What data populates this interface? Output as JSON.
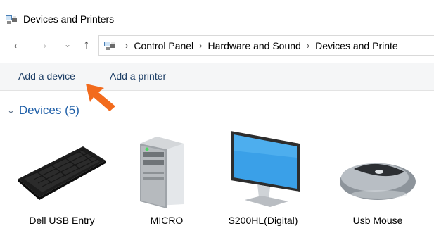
{
  "window": {
    "title": "Devices and Printers"
  },
  "navigation": {
    "back_icon": "back-arrow-icon",
    "forward_icon": "forward-arrow-icon",
    "recent_icon": "chevron-down-icon",
    "up_icon": "up-arrow-icon",
    "breadcrumbs": [
      "Control Panel",
      "Hardware and Sound",
      "Devices and Printe"
    ]
  },
  "toolbar": {
    "add_device_label": "Add a device",
    "add_printer_label": "Add a printer"
  },
  "devices_group": {
    "title": "Devices (5)",
    "items": [
      {
        "label": "Dell USB Entry",
        "icon": "keyboard-icon"
      },
      {
        "label": "MICRO",
        "icon": "computer-tower-icon"
      },
      {
        "label": "S200HL(Digital)",
        "icon": "monitor-icon"
      },
      {
        "label": "Usb Mouse",
        "icon": "mouse-icon"
      }
    ]
  },
  "colors": {
    "link": "#1e3f66",
    "group_title": "#1f5fa8",
    "annotation_arrow": "#f26b1d",
    "command_bar": "#f5f6f7"
  }
}
